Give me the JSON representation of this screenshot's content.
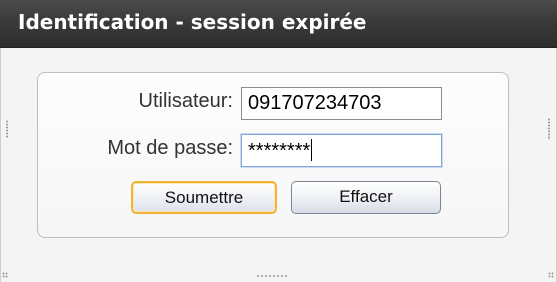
{
  "window": {
    "title": "Identification - session expirée"
  },
  "form": {
    "username_label": "Utilisateur:",
    "username_value": "091707234703",
    "password_label": "Mot de passe:",
    "password_value": "********"
  },
  "buttons": {
    "submit_label": "Soumettre",
    "clear_label": "Effacer"
  },
  "colors": {
    "titlebar": "#3a3a3a",
    "focus_border": "#f0b43c",
    "input_focus": "#7fa6d6"
  }
}
